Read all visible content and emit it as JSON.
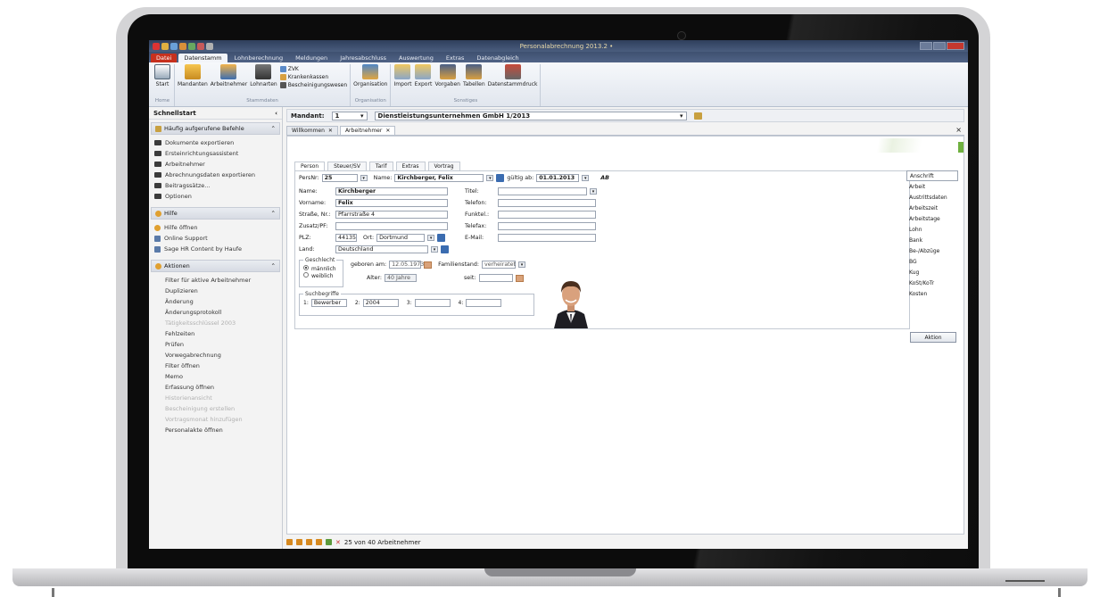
{
  "app": {
    "window_title": "Personalabrechnung 2013.2 •"
  },
  "ribbon_tabs": [
    "Datei",
    "Datenstamm",
    "Lohnberechnung",
    "Meldungen",
    "Jahresabschluss",
    "Auswertung",
    "Extras",
    "Datenabgleich"
  ],
  "ribbon": {
    "home": {
      "label": "Home",
      "start": "Start"
    },
    "stammdaten": {
      "label": "Stammdaten",
      "mandanten": "Mandanten",
      "arbeitnehmer": "Arbeitnehmer",
      "lohnarten": "Lohnarten",
      "zvk": "ZVK",
      "krankenkassen": "Krankenkassen",
      "bescheinigungswesen": "Bescheinigungswesen"
    },
    "organisation": {
      "label": "Organisation",
      "organisation": "Organisation"
    },
    "sonstiges": {
      "label": "Sonstiges",
      "import": "Import",
      "export": "Export",
      "vorgaben": "Vorgaben",
      "tabellen": "Tabellen",
      "datenstammdruck": "Datenstammdruck"
    }
  },
  "sidebar": {
    "title": "Schnellstart",
    "collapse": "‹",
    "section1": {
      "label": "Häufig aufgerufene Befehle",
      "items": [
        "Dokumente exportieren",
        "Ersteinrichtungsassistent",
        "Arbeitnehmer",
        "Abrechnungsdaten exportieren",
        "Beitragssätze...",
        "Optionen"
      ]
    },
    "section2": {
      "label": "Hilfe",
      "items": [
        "Hilfe öffnen",
        "Online Support",
        "Sage HR Content by Haufe"
      ]
    },
    "section3": {
      "label": "Aktionen",
      "items": [
        {
          "label": "Filter für aktive Arbeitnehmer",
          "dim": false
        },
        {
          "label": "Duplizieren",
          "dim": false
        },
        {
          "label": "Änderung",
          "dim": false
        },
        {
          "label": "Änderungsprotokoll",
          "dim": false
        },
        {
          "label": "Tätigkeitsschlüssel 2003",
          "dim": true
        },
        {
          "label": "Fehlzeiten",
          "dim": false
        },
        {
          "label": "Prüfen",
          "dim": false
        },
        {
          "label": "Vorwegabrechnung",
          "dim": false
        },
        {
          "label": "Filter öffnen",
          "dim": false
        },
        {
          "label": "Memo",
          "dim": false
        },
        {
          "label": "Erfassung öffnen",
          "dim": false
        },
        {
          "label": "Historienansicht",
          "dim": true
        },
        {
          "label": "Bescheinigung erstellen",
          "dim": true
        },
        {
          "label": "Vortragsmonat hinzufügen",
          "dim": true
        },
        {
          "label": "Personalakte öffnen",
          "dim": false
        }
      ]
    }
  },
  "mandant": {
    "label": "Mandant:",
    "number": "1",
    "name": "Dienstleistungsunternehmen GmbH 1/2013"
  },
  "doc_tabs": [
    {
      "label": "Willkommen",
      "close": "✕"
    },
    {
      "label": "Arbeitnehmer",
      "close": "✕"
    }
  ],
  "form_tabs": [
    "Person",
    "Steuer/SV",
    "Tarif",
    "Extras",
    "Vortrag"
  ],
  "form": {
    "persnr_label": "PersNr:",
    "persnr": "25",
    "name_label": "Name:",
    "name_value": "Kirchberger, Felix",
    "gueltig_label": "gültig ab:",
    "gueltig_value": "01.01.2013",
    "nachname_label": "Name:",
    "nachname": "Kirchberger",
    "vorname_label": "Vorname:",
    "vorname": "Felix",
    "strasse_label": "Straße, Nr.:",
    "strasse": "Pfarrstraße 4",
    "zusatz_label": "Zusatz/PF:",
    "zusatz": "",
    "plz_label": "PLZ:",
    "plz": "44135",
    "ort_label": "Ort:",
    "ort": "Dortmund",
    "land_label": "Land:",
    "land": "Deutschland",
    "titel_label": "Titel:",
    "titel": "",
    "telefon_label": "Telefon:",
    "funktel_label": "Funktel.:",
    "telefax_label": "Telefax:",
    "email_label": "E-Mail:",
    "geschlecht_label": "Geschlecht",
    "maennlich": "männlich",
    "weiblich": "weiblich",
    "geboren_label": "geboren am:",
    "geboren": "12.05.1973",
    "alter_label": "Alter:",
    "alter": "40 Jahre",
    "familienstand_label": "Familienstand:",
    "familienstand": "verheiratet",
    "seit_label": "seit:",
    "seit": "",
    "suchbegriffe_label": "Suchbegriffe",
    "s1_label": "1:",
    "s1": "Bewerber",
    "s2_label": "2:",
    "s2": "2004",
    "s3_label": "3:",
    "s3": "",
    "s4_label": "4:",
    "s4": ""
  },
  "right_list": [
    "Anschrift",
    "Arbeit",
    "Austrittsdaten",
    "Arbeitszeit",
    "Arbeitstage",
    "Lohn",
    "Bank",
    "Be-/Abzüge",
    "BG",
    "Kug",
    "KoSt/KoTr",
    "Kosten"
  ],
  "aktion_button": "Aktion",
  "navbar": {
    "status": "25 von 40 Arbeitnehmer"
  }
}
